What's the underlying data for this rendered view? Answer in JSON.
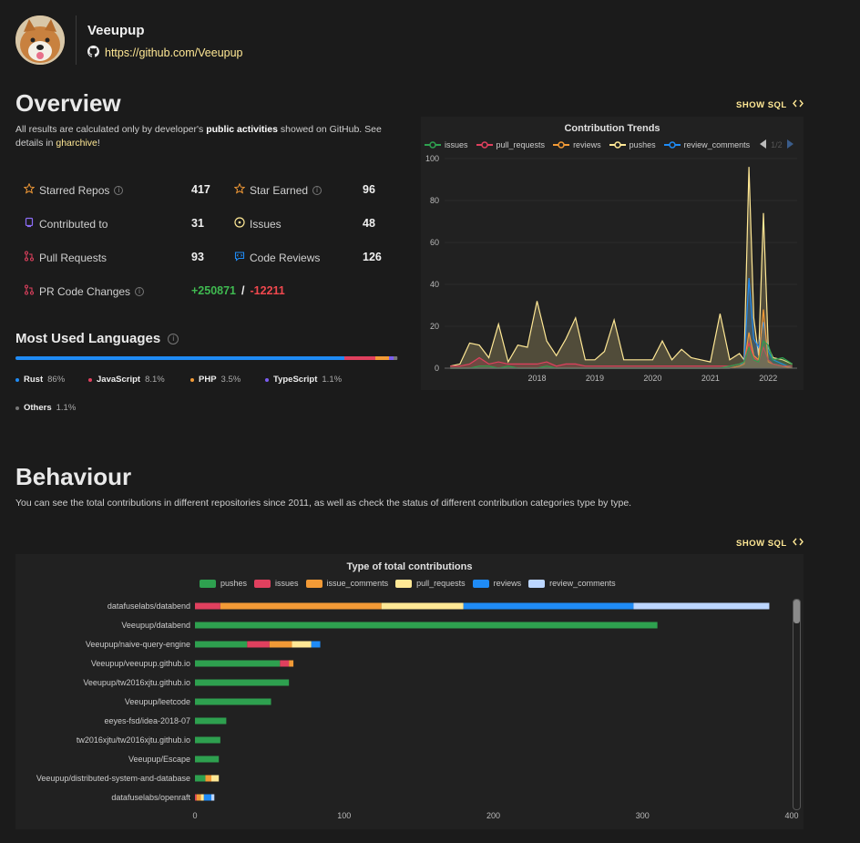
{
  "user": {
    "name": "Veeupup",
    "github_url": "https://github.com/Veeupup"
  },
  "overview": {
    "title": "Overview",
    "desc_pre": "All results are calculated only by developer's ",
    "desc_bold": "public activities",
    "desc_mid": " showed on GitHub. See details in ",
    "desc_link": "gharchive",
    "desc_end": "!",
    "show_sql": "SHOW SQL",
    "stats": {
      "starred_repos": {
        "label": "Starred Repos",
        "value": "417"
      },
      "star_earned": {
        "label": "Star Earned",
        "value": "96"
      },
      "contributed_to": {
        "label": "Contributed to",
        "value": "31"
      },
      "issues": {
        "label": "Issues",
        "value": "48"
      },
      "pull_requests": {
        "label": "Pull Requests",
        "value": "93"
      },
      "code_reviews": {
        "label": "Code Reviews",
        "value": "126"
      },
      "pr_code_changes": {
        "label": "PR Code Changes",
        "additions": "+250871",
        "separator": "/",
        "deletions": "-12211"
      }
    }
  },
  "languages": {
    "title": "Most Used Languages",
    "items": [
      {
        "name": "Rust",
        "pct": "86%",
        "value": 86,
        "color": "#1f8bf5"
      },
      {
        "name": "JavaScript",
        "pct": "8.1%",
        "value": 8.1,
        "color": "#e0405e"
      },
      {
        "name": "PHP",
        "pct": "3.5%",
        "value": 3.5,
        "color": "#f29a36"
      },
      {
        "name": "TypeScript",
        "pct": "1.1%",
        "value": 1.1,
        "color": "#7a5cf0"
      },
      {
        "name": "Others",
        "pct": "1.1%",
        "value": 1.1,
        "color": "#777777"
      }
    ]
  },
  "trends": {
    "pager": "1/2"
  },
  "behaviour": {
    "title": "Behaviour",
    "desc": "You can see the total contributions in different repositories since 2011, as well as check the status of different contribution categories type by type.",
    "show_sql": "SHOW SQL"
  },
  "chart_data": [
    {
      "type": "area",
      "title": "Contribution Trends",
      "series_names": [
        "issues",
        "pull_requests",
        "reviews",
        "pushes",
        "review_comments"
      ],
      "colors": {
        "issues": "#2ea04f",
        "pull_requests": "#e0405e",
        "reviews": "#f29a36",
        "pushes": "#ffe895",
        "review_comments": "#1f8bf5"
      },
      "ylim": [
        0,
        100
      ],
      "yticks": [
        0,
        20,
        40,
        60,
        80,
        100
      ],
      "xticks": [
        "2018",
        "2019",
        "2020",
        "2021",
        "2022"
      ],
      "x_dates": [
        "2017-01",
        "2017-03",
        "2017-05",
        "2017-07",
        "2017-09",
        "2017-11",
        "2018-01",
        "2018-03",
        "2018-05",
        "2018-07",
        "2018-09",
        "2018-11",
        "2019-01",
        "2019-03",
        "2019-05",
        "2019-07",
        "2019-09",
        "2019-11",
        "2020-01",
        "2020-03",
        "2020-05",
        "2020-07",
        "2020-09",
        "2020-11",
        "2021-01",
        "2021-03",
        "2021-05",
        "2021-07",
        "2021-09",
        "2021-11",
        "2022-01",
        "2022-02",
        "2022-03",
        "2022-04",
        "2022-05",
        "2022-06",
        "2022-07",
        "2022-08",
        "2022-10",
        "2022-12"
      ],
      "series": [
        {
          "name": "pushes",
          "values": [
            1,
            2,
            12,
            11,
            5,
            21,
            3,
            11,
            10,
            32,
            13,
            6,
            14,
            24,
            4,
            4,
            8,
            23,
            4,
            4,
            4,
            4,
            13,
            4,
            9,
            5,
            4,
            3,
            26,
            4,
            7,
            4,
            96,
            24,
            6,
            74,
            10,
            5,
            4,
            2
          ]
        },
        {
          "name": "review_comments",
          "values": [
            0,
            0,
            0,
            0,
            0,
            0,
            0,
            0,
            0,
            0,
            0,
            0,
            0,
            0,
            0,
            0,
            0,
            0,
            0,
            0,
            0,
            0,
            0,
            0,
            0,
            0,
            0,
            0,
            0,
            0,
            1,
            3,
            43,
            14,
            10,
            22,
            8,
            4,
            2,
            0
          ]
        },
        {
          "name": "reviews",
          "values": [
            0,
            0,
            0,
            0,
            0,
            0,
            0,
            0,
            0,
            0,
            0,
            0,
            0,
            0,
            0,
            0,
            0,
            0,
            0,
            0,
            0,
            0,
            0,
            0,
            0,
            0,
            0,
            0,
            0,
            0,
            1,
            2,
            17,
            6,
            4,
            28,
            3,
            2,
            1,
            0
          ]
        },
        {
          "name": "pull_requests",
          "values": [
            1,
            1,
            2,
            5,
            2,
            3,
            2,
            2,
            2,
            2,
            3,
            1,
            2,
            2,
            1,
            1,
            1,
            1,
            1,
            1,
            1,
            1,
            1,
            1,
            1,
            1,
            1,
            1,
            1,
            1,
            2,
            3,
            12,
            5,
            3,
            10,
            4,
            2,
            1,
            1
          ]
        },
        {
          "name": "issues",
          "values": [
            0,
            0,
            0,
            1,
            1,
            0,
            1,
            0,
            0,
            0,
            1,
            0,
            0,
            0,
            0,
            0,
            0,
            0,
            0,
            0,
            0,
            0,
            0,
            0,
            0,
            0,
            0,
            0,
            0,
            1,
            2,
            3,
            10,
            4,
            3,
            13,
            11,
            4,
            5,
            2
          ]
        }
      ]
    },
    {
      "type": "bar",
      "orientation": "horizontal",
      "stacked": true,
      "title": "Type of total contributions",
      "categories": [
        "datafuselabs/databend",
        "Veeupup/databend",
        "Veeupup/naive-query-engine",
        "Veeupup/veeupup.github.io",
        "Veeupup/tw2016xjtu.github.io",
        "Veeupup/leetcode",
        "eeyes-fsd/idea-2018-07",
        "tw2016xjtu/tw2016xjtu.github.io",
        "Veeupup/Escape",
        "Veeupup/distributed-system-and-database",
        "datafuselabs/openraft"
      ],
      "xlim": [
        0,
        400
      ],
      "xticks": [
        0,
        100,
        200,
        300,
        400
      ],
      "series": [
        {
          "name": "pushes",
          "color": "#2ea04f",
          "values": [
            0,
            310,
            35,
            57,
            63,
            51,
            21,
            17,
            16,
            7,
            0
          ]
        },
        {
          "name": "issues",
          "color": "#e0405e",
          "values": [
            17,
            0,
            15,
            6,
            0,
            0,
            0,
            0,
            0,
            0,
            1
          ]
        },
        {
          "name": "issue_comments",
          "color": "#f29a36",
          "values": [
            108,
            0,
            15,
            3,
            0,
            0,
            0,
            0,
            0,
            4,
            3
          ]
        },
        {
          "name": "pull_requests",
          "color": "#ffe895",
          "values": [
            55,
            0,
            13,
            0,
            0,
            0,
            0,
            0,
            0,
            5,
            2
          ]
        },
        {
          "name": "reviews",
          "color": "#1f8bf5",
          "values": [
            114,
            0,
            6,
            0,
            0,
            0,
            0,
            0,
            0,
            0,
            5
          ]
        },
        {
          "name": "review_comments",
          "color": "#bcd6ff",
          "values": [
            91,
            0,
            0,
            0,
            0,
            0,
            0,
            0,
            0,
            0,
            2
          ]
        }
      ]
    }
  ]
}
